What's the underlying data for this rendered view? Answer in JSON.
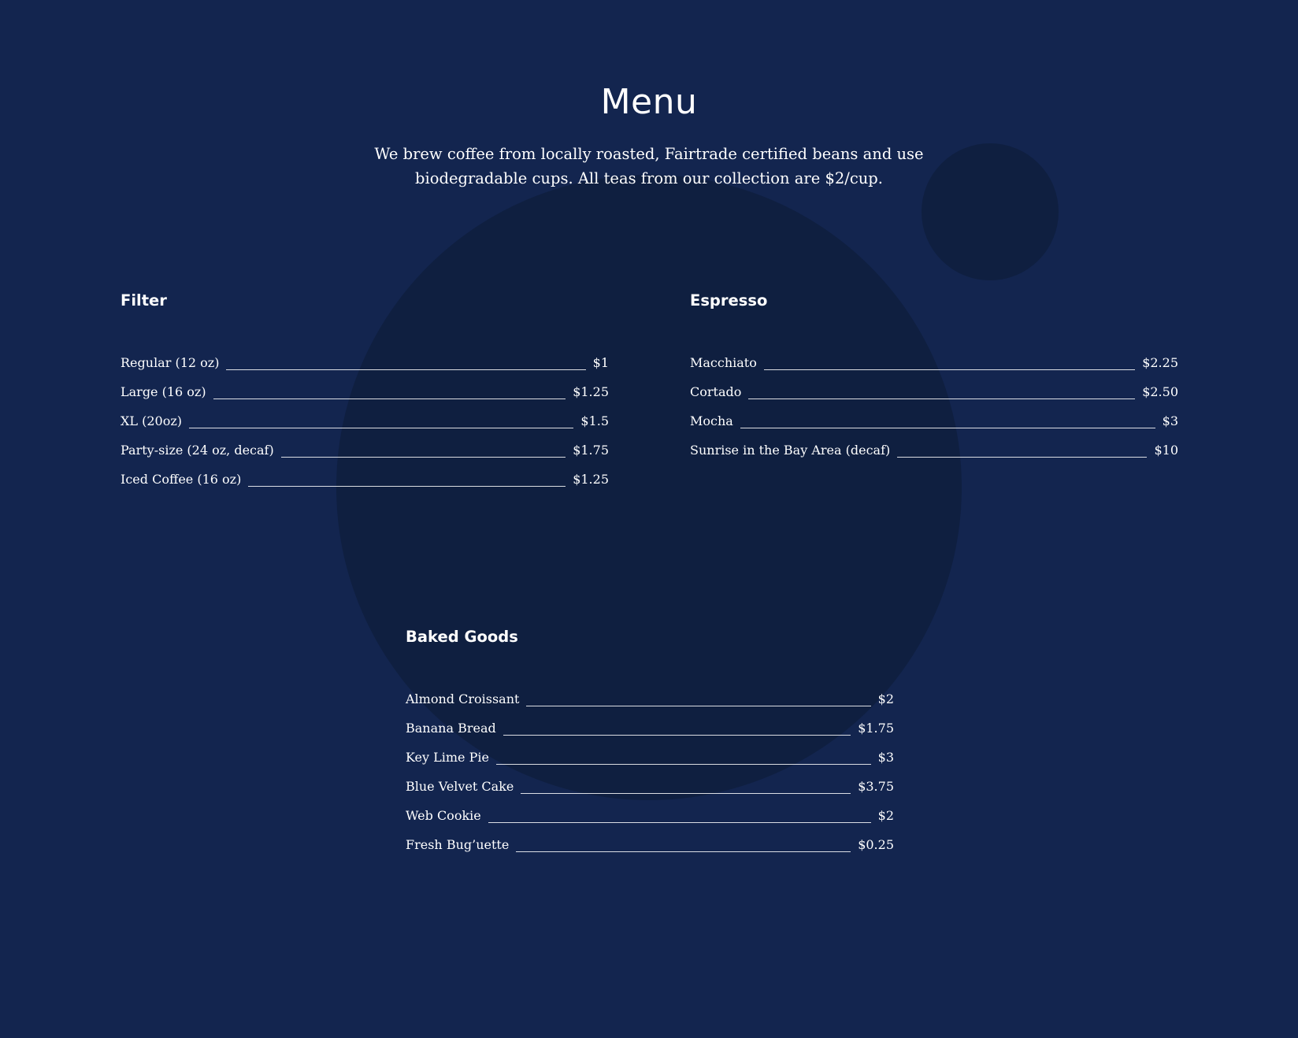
{
  "page": {
    "title": "Menu",
    "intro": "We brew coffee from locally roasted, Fairtrade certified beans and use biodegradable cups. All teas from our collection are $2/cup."
  },
  "colors": {
    "background": "#13254f",
    "accent_shape": "#0f1f40",
    "text": "#ffffff"
  },
  "sections": [
    {
      "heading": "Filter",
      "items": [
        {
          "name": "Regular (12 oz)",
          "price": "$1"
        },
        {
          "name": "Large (16 oz)",
          "price": "$1.25"
        },
        {
          "name": "XL (20oz)",
          "price": "$1.5"
        },
        {
          "name": "Party-size (24 oz, decaf)",
          "price": "$1.75"
        },
        {
          "name": "Iced Coffee (16 oz)",
          "price": "$1.25"
        }
      ]
    },
    {
      "heading": "Espresso",
      "items": [
        {
          "name": "Macchiato",
          "price": "$2.25"
        },
        {
          "name": "Cortado",
          "price": "$2.50"
        },
        {
          "name": "Mocha",
          "price": "$3"
        },
        {
          "name": "Sunrise in the Bay Area (decaf)",
          "price": "$10"
        }
      ]
    },
    {
      "heading": "Baked Goods",
      "items": [
        {
          "name": "Almond Croissant",
          "price": "$2"
        },
        {
          "name": "Banana Bread",
          "price": "$1.75"
        },
        {
          "name": "Key Lime Pie",
          "price": "$3"
        },
        {
          "name": "Blue Velvet Cake",
          "price": "$3.75"
        },
        {
          "name": "Web Cookie",
          "price": "$2"
        },
        {
          "name": "Fresh Bug’uette",
          "price": "$0.25"
        }
      ]
    }
  ]
}
